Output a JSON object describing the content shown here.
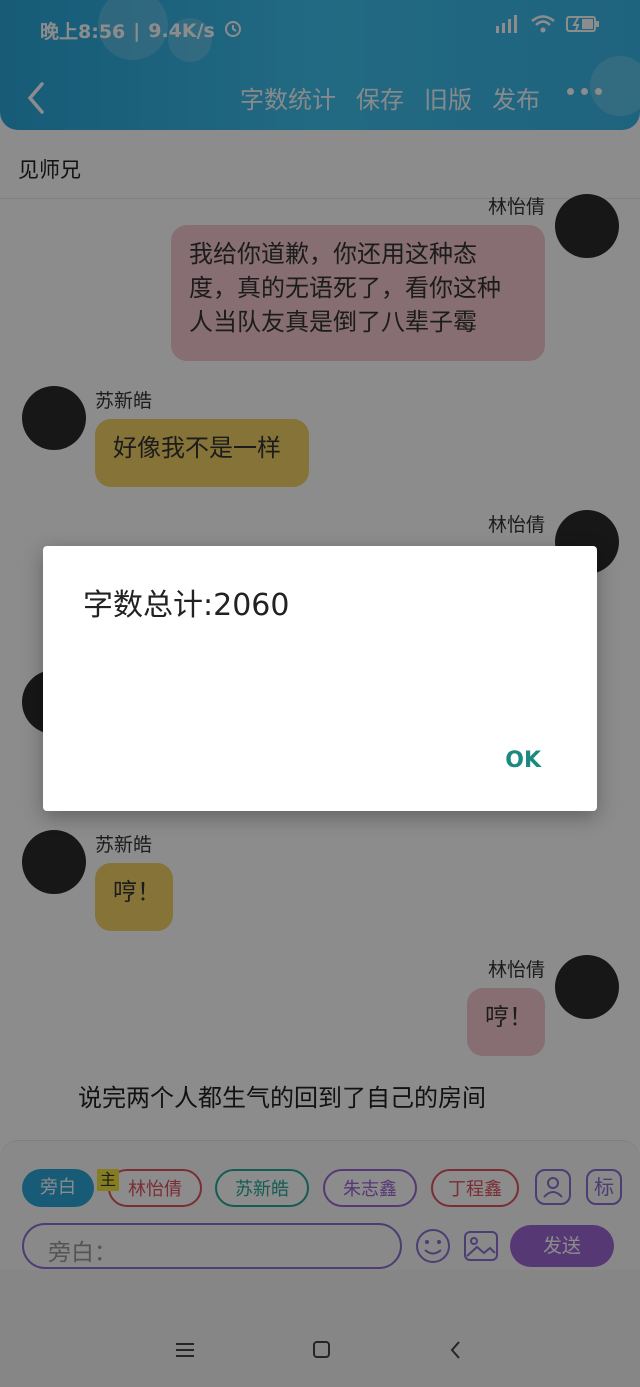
{
  "status_bar": {
    "time": "晚上8:56",
    "separator": "|",
    "network_speed": "9.4K/s",
    "icons": [
      "alarm-icon",
      "signal-icon",
      "wifi-icon",
      "battery-charging-icon"
    ]
  },
  "header": {
    "actions": [
      "字数统计",
      "保存",
      "旧版",
      "发布"
    ],
    "back_icon": "chevron-left-icon",
    "more_icon": "more-dots-icon"
  },
  "page_title": "见师兄",
  "chat": {
    "messages": [
      {
        "side": "right",
        "name": "林怡倩",
        "lines": [
          "我给你道歉，你还用这种态",
          "度，真的无语死了，看你这种",
          "人当队友真是倒了八辈子霉"
        ],
        "color": "pink"
      },
      {
        "side": "left",
        "name": "苏新皓",
        "lines": [
          "好像我不是一样"
        ],
        "color": "yellow"
      },
      {
        "side": "right",
        "name": "林怡倩",
        "lines": [],
        "color": "pink"
      },
      {
        "side": "left",
        "name": "苏新皓",
        "lines": [
          "哼！"
        ],
        "color": "yellow"
      },
      {
        "side": "right",
        "name": "林怡倩",
        "lines": [
          "哼！"
        ],
        "color": "pink"
      }
    ],
    "narration": "说完两个人都生气的回到了自己的房间"
  },
  "composer": {
    "chips": [
      {
        "label": "旁白",
        "style": "active",
        "color": "#2aa6d9"
      },
      {
        "label": "林怡倩",
        "style": "outline",
        "color": "#e0525f"
      },
      {
        "label": "苏新皓",
        "style": "outline",
        "color": "#27a89a"
      },
      {
        "label": "朱志鑫",
        "style": "outline",
        "color": "#9d66d6"
      },
      {
        "label": "丁程鑫",
        "style": "outline",
        "color": "#e0525f"
      }
    ],
    "main_tag": "主",
    "mark_button": "标",
    "input_placeholder": "旁白：",
    "send_label": "发送"
  },
  "dialog": {
    "title": "字数总计:2060",
    "ok_label": "OK"
  },
  "colors": {
    "header_blue": "#3ab6e6",
    "pink_bubble": "#f4c9d0",
    "yellow_bubble": "#f3d267",
    "accent_purple": "#9d66d6",
    "ok_teal": "#1a8a80"
  }
}
